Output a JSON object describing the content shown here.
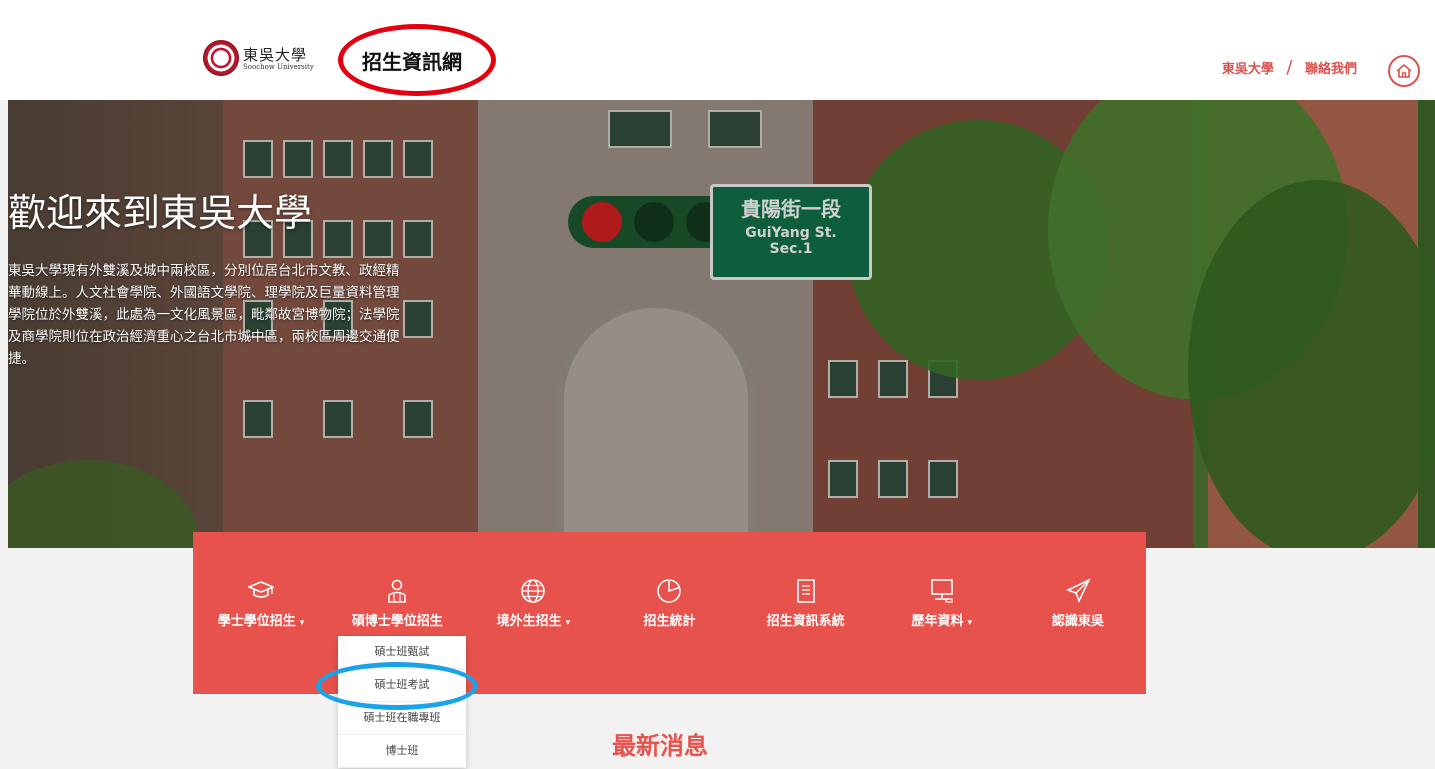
{
  "header": {
    "logo_cn": "東吳大學",
    "logo_en": "Soochow University",
    "site_title": "招生資訊網",
    "links": [
      "東吳大學",
      "聯絡我們"
    ],
    "link_separator": "/"
  },
  "hero": {
    "title": "歡迎來到東吳大學",
    "body": "東吳大學現有外雙溪及城中兩校區，分別位居台北市文教、政經精華動線上。人文社會學院、外國語文學院、理學院及巨量資料管理學院位於外雙溪，此處為一文化風景區，毗鄰故宮博物院；法學院及商學院則位在政治經濟重心之台北市城中區，兩校區周邊交通便捷。",
    "sign_line1": "貴陽街一段",
    "sign_line2": "GuiYang St.",
    "sign_line3": "Sec.1"
  },
  "nav": {
    "items": [
      {
        "label": "學士學位招生",
        "icon": "graduation-cap-icon",
        "has_dropdown": true
      },
      {
        "label": "碩博士學位招生",
        "icon": "graduate-person-icon",
        "has_dropdown": false
      },
      {
        "label": "境外生招生",
        "icon": "globe-icon",
        "has_dropdown": true
      },
      {
        "label": "招生統計",
        "icon": "pie-chart-icon",
        "has_dropdown": false
      },
      {
        "label": "招生資訊系統",
        "icon": "document-icon",
        "has_dropdown": false
      },
      {
        "label": "歷年資料",
        "icon": "computer-icon",
        "has_dropdown": true
      },
      {
        "label": "認識東吳",
        "icon": "paper-plane-icon",
        "has_dropdown": false
      }
    ],
    "caret": "▾"
  },
  "dropdown": {
    "items": [
      "碩士班甄試",
      "碩士班考試",
      "碩士班在職專班",
      "博士班"
    ]
  },
  "news": {
    "title": "最新消息"
  },
  "colors": {
    "accent": "#e8524c",
    "highlight_red": "#e3000f",
    "highlight_blue": "#1aa3e8"
  }
}
